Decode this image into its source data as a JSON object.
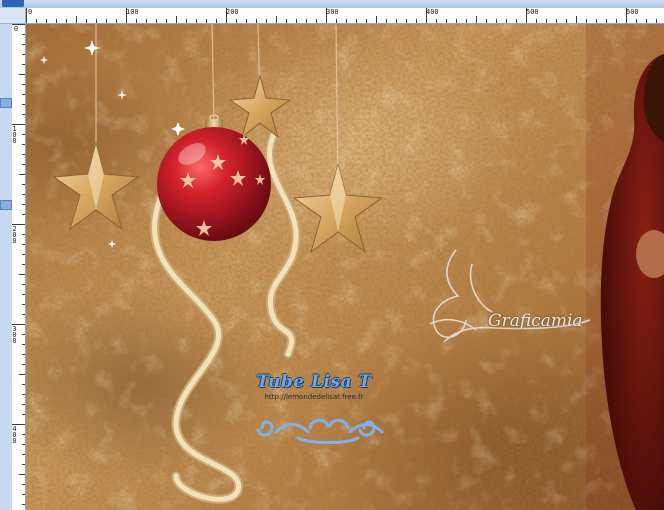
{
  "ruler": {
    "horizontal_labels": [
      "0",
      "100",
      "200",
      "300",
      "400",
      "500",
      "600"
    ],
    "vertical_labels": [
      "0",
      "100",
      "200",
      "300",
      "400"
    ]
  },
  "canvas": {
    "tube_title": "Tube Lisa T",
    "tube_url": "http://lemondedelisat.free.fr",
    "signature": "Graficamia"
  },
  "colors": {
    "background_brown": "#b27a3f",
    "ornament_red": "#c8202a",
    "star_gold": "#dcae6c",
    "ribbon_cream": "#efd9a8",
    "ruler_blue": "#c6d9f1"
  },
  "icons": [
    "gold-star-icon",
    "red-bauble-icon",
    "sparkle-icon",
    "curly-ribbon-icon",
    "scroll-ornament-icon"
  ]
}
